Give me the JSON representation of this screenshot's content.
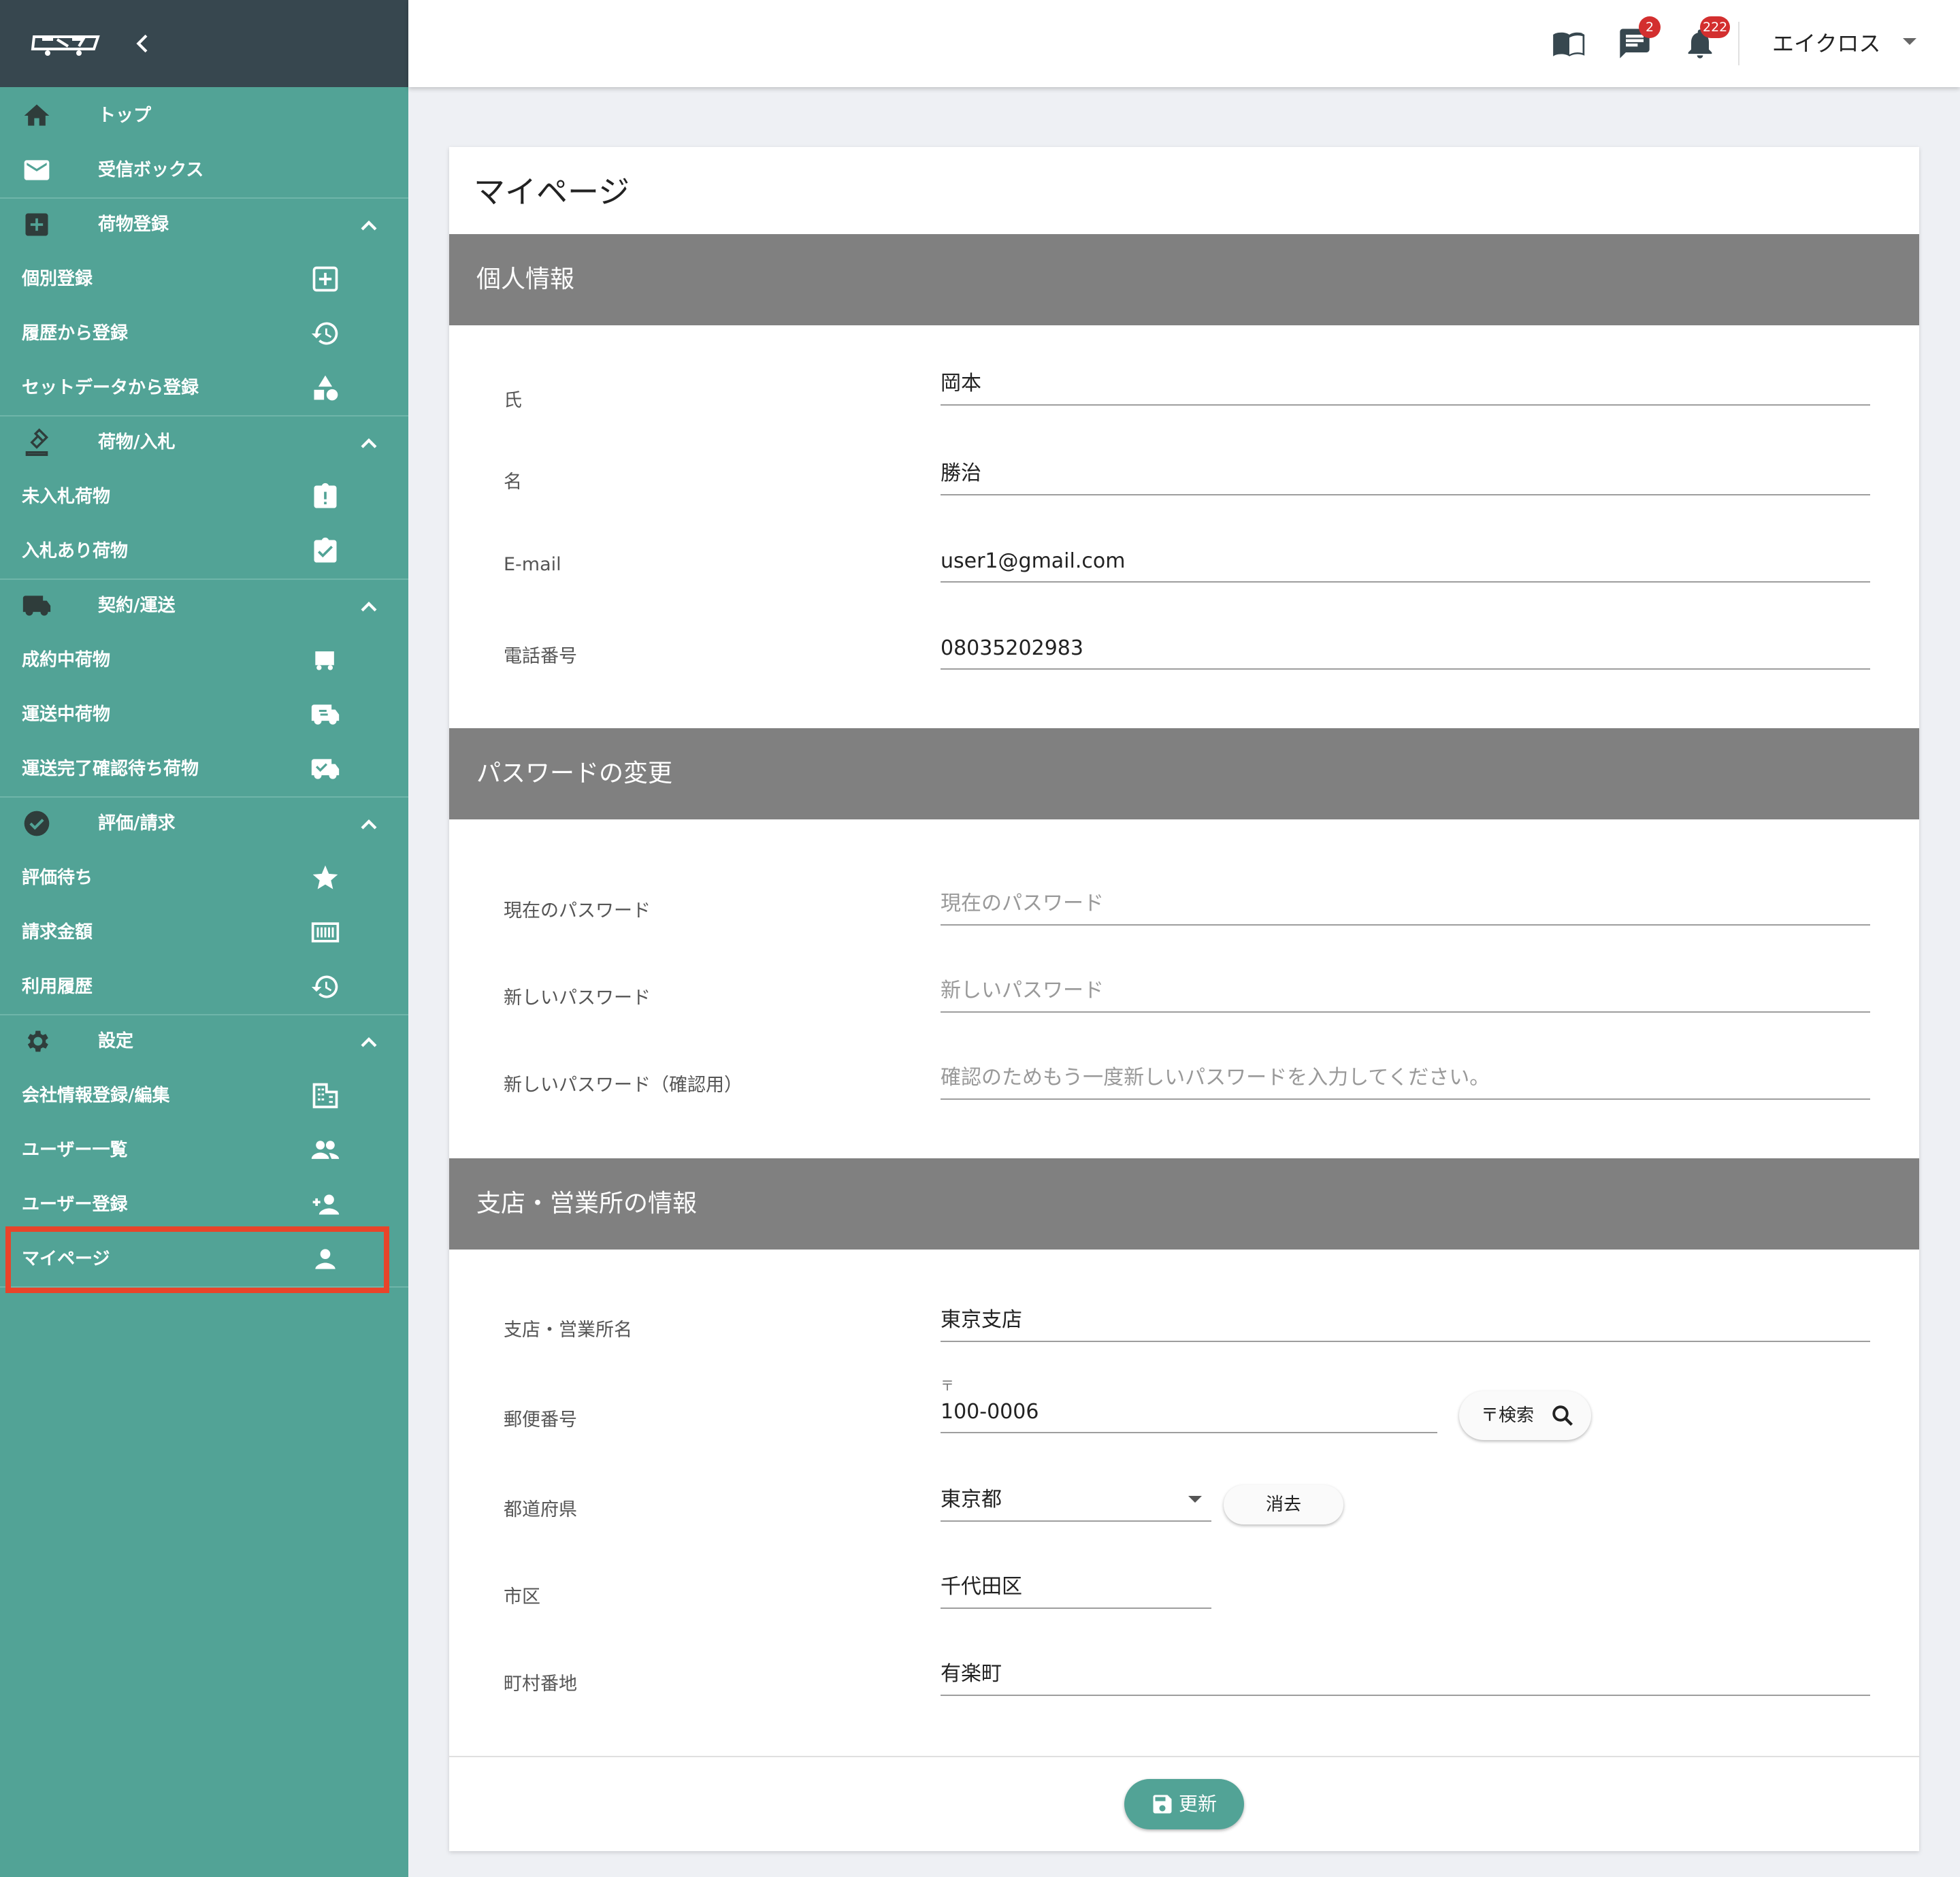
{
  "sidebar": {
    "items": {
      "top": "トップ",
      "inbox": "受信ボックス",
      "cargo_reg": "荷物登録",
      "individual_reg": "個別登録",
      "history_reg": "履歴から登録",
      "setdata_reg": "セットデータから登録",
      "cargo_bid": "荷物/入札",
      "unbid_cargo": "未入札荷物",
      "bid_cargo": "入札あり荷物",
      "contract_transport": "契約/運送",
      "contracted_cargo": "成約中荷物",
      "in_transit_cargo": "運送中荷物",
      "awaiting_confirm_cargo": "運送完了確認待ち荷物",
      "eval_billing": "評価/請求",
      "awaiting_eval": "評価待ち",
      "billing_amount": "請求金額",
      "usage_history": "利用履歴",
      "settings": "設定",
      "company_info": "会社情報登録/編集",
      "user_list": "ユーザー一覧",
      "user_reg": "ユーザー登録",
      "mypage": "マイページ"
    }
  },
  "header": {
    "messages_badge": "2",
    "notifications_badge": "222",
    "user_name": "エイクロス"
  },
  "page": {
    "title": "マイページ",
    "personal": {
      "heading": "個人情報",
      "last_name_label": "氏",
      "last_name": "岡本",
      "first_name_label": "名",
      "first_name": "勝治",
      "email_label": "E-mail",
      "email": "user1@gmail.com",
      "phone_label": "電話番号",
      "phone": "08035202983"
    },
    "password": {
      "heading": "パスワードの変更",
      "current_label": "現在のパスワード",
      "current_placeholder": "現在のパスワード",
      "new_label": "新しいパスワード",
      "new_placeholder": "新しいパスワード",
      "confirm_label": "新しいパスワード（確認用）",
      "confirm_placeholder": "確認のためもう一度新しいパスワードを入力してください。"
    },
    "branch": {
      "heading": "支店・営業所の情報",
      "name_label": "支店・営業所名",
      "name": "東京支店",
      "postal_label": "郵便番号",
      "postal_prefix": "〒",
      "postal": "100-0006",
      "postal_search_label": "〒検索",
      "prefecture_label": "都道府県",
      "prefecture": "東京都",
      "clear_label": "消去",
      "city_label": "市区",
      "city": "千代田区",
      "town_label": "町村番地",
      "town": "有楽町"
    },
    "update_label": "更新"
  },
  "colors": {
    "sidebar_bg": "#52a396",
    "sidebar_top_bg": "#37474f",
    "section_header_bg": "#808080",
    "highlight_border": "#e8442a",
    "badge": "#d32f2f"
  }
}
